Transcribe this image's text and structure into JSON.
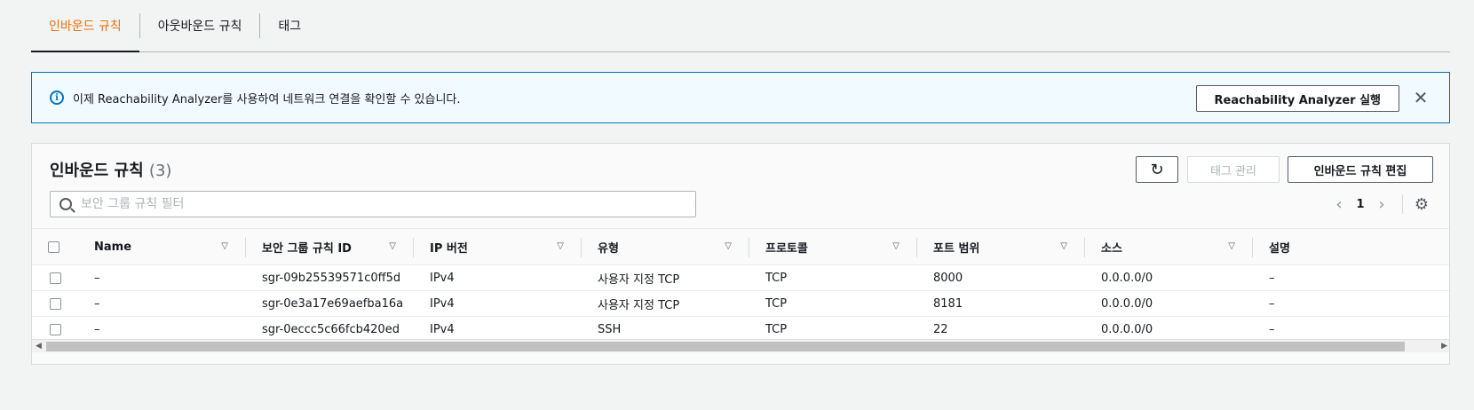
{
  "tabs": [
    {
      "label": "인바운드 규칙",
      "active": true
    },
    {
      "label": "아웃바운드 규칙",
      "active": false
    },
    {
      "label": "태그",
      "active": false
    }
  ],
  "banner": {
    "message": "이제 Reachability Analyzer를 사용하여 네트워크 연결을 확인할 수 있습니다.",
    "button_label": "Reachability Analyzer 실행",
    "close_glyph": "✕",
    "info_glyph": "i"
  },
  "panel": {
    "title": "인바운드 규칙",
    "count": "(3)",
    "refresh_glyph": "↻",
    "tag_manage_label": "태그 관리",
    "edit_label": "인바운드 규칙 편집",
    "filter_placeholder": "보안 그룹 규칙 필터",
    "page": "1",
    "prev_glyph": "‹",
    "next_glyph": "›",
    "gear_glyph": "⚙"
  },
  "table": {
    "columns": [
      "Name",
      "보안 그룹 규칙 ID",
      "IP 버전",
      "유형",
      "프로토콜",
      "포트 범위",
      "소스",
      "설명"
    ],
    "sort_glyph": "▽",
    "rows": [
      {
        "name": "–",
        "id": "sgr-09b25539571c0ff5d",
        "ip": "IPv4",
        "type": "사용자 지정 TCP",
        "proto": "TCP",
        "port": "8000",
        "src": "0.0.0.0/0",
        "desc": "–"
      },
      {
        "name": "–",
        "id": "sgr-0e3a17e69aefba16a",
        "ip": "IPv4",
        "type": "사용자 지정 TCP",
        "proto": "TCP",
        "port": "8181",
        "src": "0.0.0.0/0",
        "desc": "–"
      },
      {
        "name": "–",
        "id": "sgr-0eccc5c66fcb420ed",
        "ip": "IPv4",
        "type": "SSH",
        "proto": "TCP",
        "port": "22",
        "src": "0.0.0.0/0",
        "desc": "–"
      }
    ]
  },
  "colors": {
    "accent": "#ec7211",
    "info_blue": "#0073bb",
    "banner_bg": "#f1faff"
  }
}
